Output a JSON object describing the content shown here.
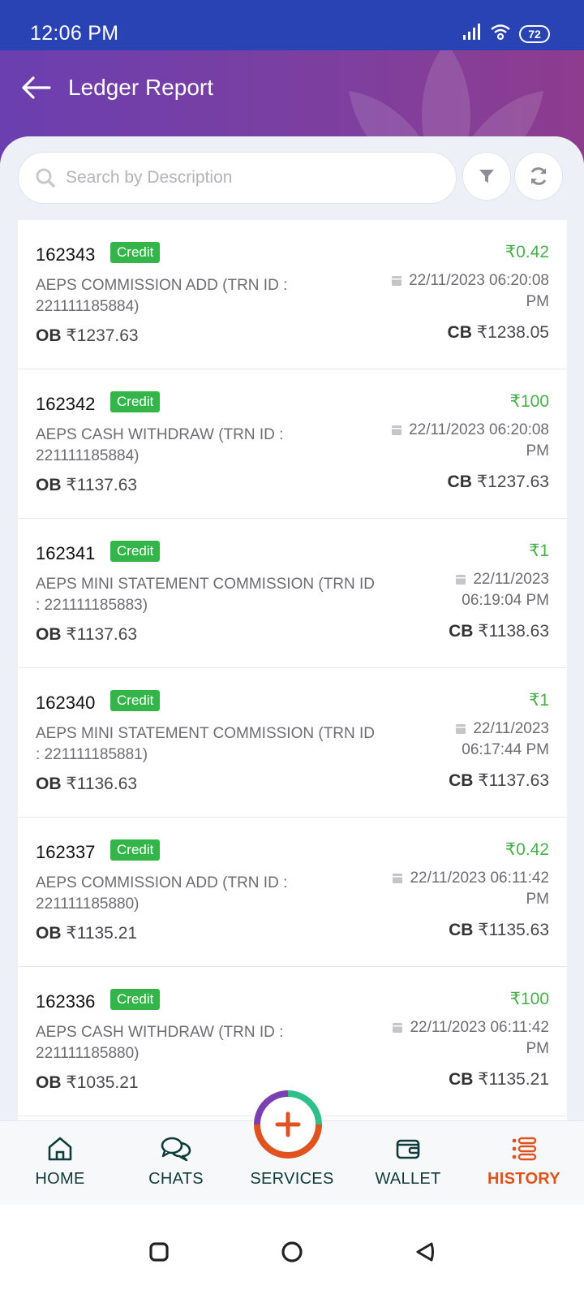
{
  "status_bar": {
    "time": "12:06 PM",
    "battery": "72",
    "icons": [
      "signal-icon",
      "wifi-icon",
      "battery-icon"
    ]
  },
  "header": {
    "title": "Ledger Report",
    "back_icon": "arrow-left-icon"
  },
  "search": {
    "placeholder": "Search by Description",
    "value": ""
  },
  "ledger": [
    {
      "id": "162343",
      "type": "Credit",
      "amount": "₹0.42",
      "description": "AEPS COMMISSION ADD (TRN ID : 221111185884)",
      "date_line1": "22/11/2023 06:20:08",
      "date_line2": "PM",
      "ob_label": "OB",
      "ob": "₹1237.63",
      "cb_label": "CB",
      "cb": "₹1238.05"
    },
    {
      "id": "162342",
      "type": "Credit",
      "amount": "₹100",
      "description": "AEPS CASH WITHDRAW (TRN ID : 221111185884)",
      "date_line1": "22/11/2023 06:20:08",
      "date_line2": "PM",
      "ob_label": "OB",
      "ob": "₹1137.63",
      "cb_label": "CB",
      "cb": "₹1237.63"
    },
    {
      "id": "162341",
      "type": "Credit",
      "amount": "₹1",
      "description": "AEPS MINI STATEMENT COMMISSION (TRN ID : 221111185883)",
      "date_line1": "22/11/2023",
      "date_line2": "06:19:04 PM",
      "ob_label": "OB",
      "ob": "₹1137.63",
      "cb_label": "CB",
      "cb": "₹1138.63"
    },
    {
      "id": "162340",
      "type": "Credit",
      "amount": "₹1",
      "description": "AEPS MINI STATEMENT COMMISSION (TRN ID : 221111185881)",
      "date_line1": "22/11/2023",
      "date_line2": "06:17:44 PM",
      "ob_label": "OB",
      "ob": "₹1136.63",
      "cb_label": "CB",
      "cb": "₹1137.63"
    },
    {
      "id": "162337",
      "type": "Credit",
      "amount": "₹0.42",
      "description": "AEPS COMMISSION ADD (TRN ID : 221111185880)",
      "date_line1": "22/11/2023 06:11:42",
      "date_line2": "PM",
      "ob_label": "OB",
      "ob": "₹1135.21",
      "cb_label": "CB",
      "cb": "₹1135.63"
    },
    {
      "id": "162336",
      "type": "Credit",
      "amount": "₹100",
      "description": "AEPS CASH WITHDRAW (TRN ID : 221111185880)",
      "date_line1": "22/11/2023 06:11:42",
      "date_line2": "PM",
      "ob_label": "OB",
      "ob": "₹1035.21",
      "cb_label": "CB",
      "cb": "₹1135.21"
    }
  ],
  "bottom_nav": [
    {
      "label": "HOME",
      "icon": "home-icon",
      "active": false
    },
    {
      "label": "CHATS",
      "icon": "chat-icon",
      "active": false
    },
    {
      "label": "SERVICES",
      "icon": "plus-icon",
      "active": false
    },
    {
      "label": "WALLET",
      "icon": "wallet-icon",
      "active": false
    },
    {
      "label": "HISTORY",
      "icon": "history-icon",
      "active": true
    }
  ],
  "colors": {
    "status_bar": "#2a43b4",
    "header": "#7440a6",
    "credit_badge": "#34b54a",
    "amount": "#47b04b",
    "active_nav": "#e0531e",
    "nav_text": "#0f3c3a"
  }
}
